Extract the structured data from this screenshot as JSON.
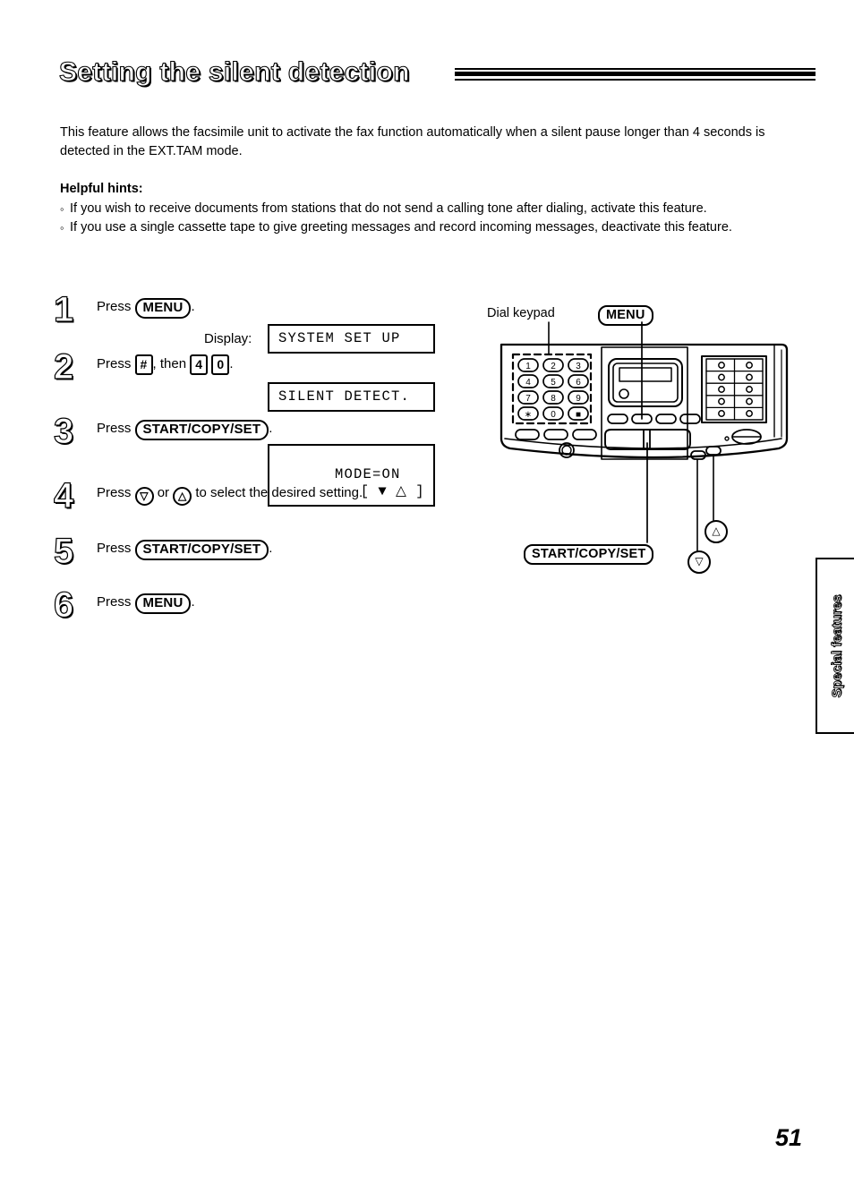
{
  "page": {
    "title": "Setting the silent detection",
    "number": "51",
    "side_tab": "Special features"
  },
  "intro": "This feature allows the facsimile unit to activate the fax function automatically when a silent pause longer than 4 seconds is detected in the EXT.TAM mode.",
  "hints": {
    "heading": "Helpful hints:",
    "bullet_glyph": "◦",
    "items": [
      "If you wish to receive documents from stations that do not send a calling tone after dialing, activate this feature.",
      "If you use a single cassette tape to give greeting messages and record incoming messages, deactivate this feature."
    ]
  },
  "steps": {
    "display_label": "Display:",
    "s1": {
      "number": "1",
      "press": "Press",
      "key": "MENU",
      "period": ".",
      "lcd": "SYSTEM SET UP"
    },
    "s2": {
      "number": "2",
      "press": "Press",
      "key_hash": "#",
      "then": ", then",
      "key_4": "4",
      "key_0": "0",
      "period": ".",
      "lcd": "SILENT DETECT."
    },
    "s3": {
      "number": "3",
      "press": "Press",
      "key": "START/COPY/SET",
      "period": ".",
      "lcd_left": "MODE=ON",
      "lcd_right": "[ ▼ △ ]"
    },
    "s4": {
      "number": "4",
      "press": "Press",
      "key_down": "▽",
      "or": "or",
      "key_up": "△",
      "tail": "to select the desired setting."
    },
    "s5": {
      "number": "5",
      "press": "Press",
      "key": "START/COPY/SET",
      "period": "."
    },
    "s6": {
      "number": "6",
      "press": "Press",
      "key": "MENU",
      "period": "."
    }
  },
  "diagram": {
    "label_dial_keypad": "Dial keypad",
    "label_menu": "MENU",
    "label_start_copy_set": "START/COPY/SET",
    "label_up_arrow": "△",
    "label_down_arrow": "▽",
    "keypad_keys": [
      "1",
      "2",
      "3",
      "4",
      "5",
      "6",
      "7",
      "8",
      "9",
      "∗",
      "0",
      "■"
    ]
  },
  "colors": {
    "ink": "#000000",
    "paper": "#ffffff"
  }
}
